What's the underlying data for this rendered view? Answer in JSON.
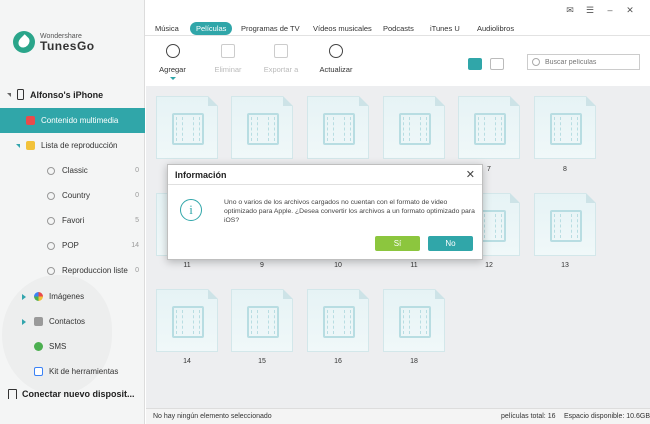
{
  "app": {
    "brand": "Wondershare",
    "name": "TunesGo"
  },
  "sidebar": {
    "device": "Alfonso's iPhone",
    "items": [
      {
        "label": "Contenido multimedia"
      },
      {
        "label": "Lista de reproducción"
      },
      {
        "label": "Imágenes"
      },
      {
        "label": "Contactos"
      },
      {
        "label": "SMS"
      },
      {
        "label": "Kit de herramientas"
      }
    ],
    "playlists": [
      {
        "name": "Classic",
        "count": "0"
      },
      {
        "name": "Country",
        "count": "0"
      },
      {
        "name": "Favori",
        "count": "5"
      },
      {
        "name": "POP",
        "count": "14"
      },
      {
        "name": "Reproduccion liste",
        "count": "0"
      }
    ],
    "connect": "Conectar nuevo disposit..."
  },
  "tabs": [
    "Música",
    "Películas",
    "Programas de TV",
    "Vídeos musicales",
    "Podcasts",
    "iTunes U",
    "Audiolibros"
  ],
  "toolbar": {
    "add": "Agregar",
    "delete": "Eliminar",
    "export": "Exportar a",
    "refresh": "Actualizar"
  },
  "search": {
    "placeholder": "Buscar películas"
  },
  "cards": {
    "row1": [
      "",
      "",
      "",
      "",
      "7",
      "8"
    ],
    "row2": [
      "11",
      "9",
      "10",
      "11",
      "12",
      "13"
    ],
    "row3": [
      "14",
      "15",
      "16",
      "18"
    ]
  },
  "status": {
    "selection": "No hay ningún elemento seleccionado",
    "total": "películas total: 16",
    "space": "Espacio disponible: 10.6GB"
  },
  "dialog": {
    "title": "Información",
    "message": "Uno o varios de los archivos cargados no cuentan con el formato de video optimizado para Apple. ¿Desea convertir los archivos a un formato optimizado para iOS?",
    "yes": "Sí",
    "no": "No"
  },
  "colors": {
    "accent": "#30a6a9",
    "yes": "#8cc63e"
  }
}
